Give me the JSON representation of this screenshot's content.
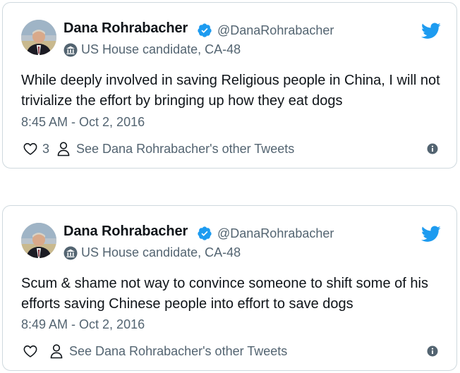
{
  "colors": {
    "text": "#0f1419",
    "secondary": "#536471",
    "accent": "#1d9bf0",
    "border": "#cfd9de"
  },
  "tweets": [
    {
      "author_name": "Dana Rohrabacher",
      "handle": "@DanaRohrabacher",
      "verified_icon": "verified-badge-icon",
      "label_icon": "government-building-icon",
      "label": "US House candidate, CA-48",
      "text": "While deeply involved in saving Religious people in China, I will not trivialize the effort by bringing up how they eat dogs",
      "timestamp": "8:45 AM - Oct 2, 2016",
      "likes": "3",
      "other_tweets_link": "See Dana Rohrabacher's other Tweets"
    },
    {
      "author_name": "Dana Rohrabacher",
      "handle": "@DanaRohrabacher",
      "verified_icon": "verified-badge-icon",
      "label_icon": "government-building-icon",
      "label": "US House candidate, CA-48",
      "text": "Scum & shame not way to convince someone to shift some of his efforts saving Chinese people into effort to save dogs",
      "timestamp": "8:49 AM - Oct 2, 2016",
      "likes": "",
      "other_tweets_link": "See Dana Rohrabacher's other Tweets"
    }
  ]
}
